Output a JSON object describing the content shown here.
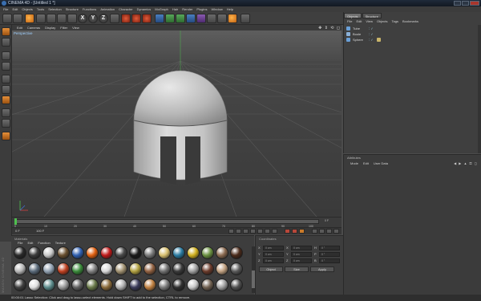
{
  "window": {
    "title": "CINEMA 4D - [Untitled 1 *]"
  },
  "menu": [
    "File",
    "Edit",
    "Objects",
    "Tools",
    "Selection",
    "Structure",
    "Functions",
    "Animation",
    "Character",
    "Dynamics",
    "MoGraph",
    "Hair",
    "Render",
    "Plugins",
    "Window",
    "Help"
  ],
  "toolbar": {
    "axis_x": "X",
    "axis_y": "Y",
    "axis_z": "Z"
  },
  "viewport": {
    "menu": [
      "Edit",
      "Cameras",
      "Display",
      "Filter",
      "View"
    ],
    "label": "Perspective",
    "nav_icons": "✥ ⇕ ⟲ ◻"
  },
  "timeline": {
    "ticks": [
      "0",
      "10",
      "20",
      "30",
      "40",
      "50",
      "60",
      "70",
      "80",
      "90",
      "100"
    ],
    "current_frame": "0 F",
    "end_frame": "0 F",
    "end_frame2": "100 F",
    "fps": "0 F"
  },
  "materials": {
    "title": "Materials",
    "menu": [
      "File",
      "Edit",
      "Function",
      "Texture"
    ],
    "swatches": [
      "#2a2a2a",
      "#3c3c3c",
      "#c9c9c9",
      "#6a5030",
      "#2f5fb0",
      "#e06010",
      "#c01a1a",
      "#4a4a4a",
      "#1a1a1a",
      "#7a7a7a",
      "#d8c070",
      "#2a7aa0",
      "#d0b020",
      "#6a9040",
      "#8a6a50",
      "#4a2a1a",
      "#b8b8b8",
      "#5a6a7a",
      "#90a0b0",
      "#c04020",
      "#3a8a3a",
      "#808080",
      "#d8d8d8",
      "#a09070",
      "#b0a040",
      "#906040",
      "#707070",
      "#3a3a3a",
      "#a0a0a0",
      "#6a3a2a",
      "#c0a080",
      "#5a5a5a",
      "#404040",
      "#e0e0e0",
      "#5a8a8a",
      "#9a9a9a",
      "#606060",
      "#6a7a4a",
      "#8a6a3a",
      "#b0b0b0",
      "#3a3a5a",
      "#c08040",
      "#7a7a7a",
      "#303030",
      "#c8c8c8",
      "#706050",
      "#a0a0a0",
      "#505050"
    ]
  },
  "logo": {
    "text": "MAXON CINEMA 4D"
  },
  "coordinates": {
    "title": "Coordinates",
    "rows": [
      {
        "axis": "X",
        "pos": "0 cm",
        "size": "0 cm",
        "rot_label": "H",
        "rot": "0 °"
      },
      {
        "axis": "Y",
        "pos": "0 cm",
        "size": "0 cm",
        "rot_label": "P",
        "rot": "0 °"
      },
      {
        "axis": "Z",
        "pos": "0 cm",
        "size": "0 cm",
        "rot_label": "B",
        "rot": "0 °"
      }
    ],
    "mode": "Object",
    "size_mode": "Size",
    "apply": "Apply"
  },
  "objects": {
    "tabs": [
      "Objects",
      "Structure"
    ],
    "menu": [
      "File",
      "Edit",
      "View",
      "Objects",
      "Tags",
      "Bookmarks"
    ],
    "items": [
      "Tube",
      "Boole",
      "Sphere"
    ]
  },
  "attributes": {
    "title": "Attributes",
    "menu": [
      "Mode",
      "Edit",
      "User Data"
    ],
    "nav": "◀ ▶ ▲ ⚿ ◻"
  },
  "status": {
    "text": "00:00:01    Lasso Selection: Click and drag to lasso-select elements. Hold down SHIFT to add to the selection, CTRL to remove."
  },
  "colors": {
    "accent": "#4ec04e",
    "viewport_bg": "#4c4c4c",
    "grid": "#5a5a5a"
  }
}
